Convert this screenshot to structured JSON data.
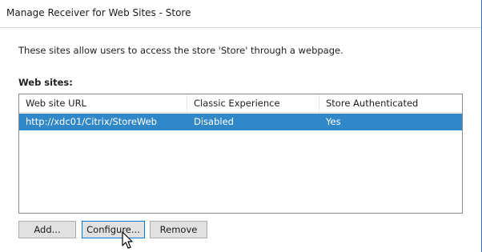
{
  "dialog": {
    "title": "Manage Receiver for Web Sites - Store",
    "description": "These sites allow users to access the store 'Store' through a webpage.",
    "section_label": "Web sites:"
  },
  "table": {
    "columns": [
      "Web site URL",
      "Classic Experience",
      "Store Authenticated"
    ],
    "rows": [
      {
        "url": "http://xdc01/Citrix/StoreWeb",
        "classic": "Disabled",
        "authenticated": "Yes",
        "selected": true
      }
    ]
  },
  "buttons": {
    "add": "Add...",
    "configure": "Configure...",
    "remove": "Remove"
  },
  "colors": {
    "selection": "#3088c8",
    "window_border": "#1e7ad2"
  },
  "icons": [
    "mouse-cursor-icon"
  ]
}
